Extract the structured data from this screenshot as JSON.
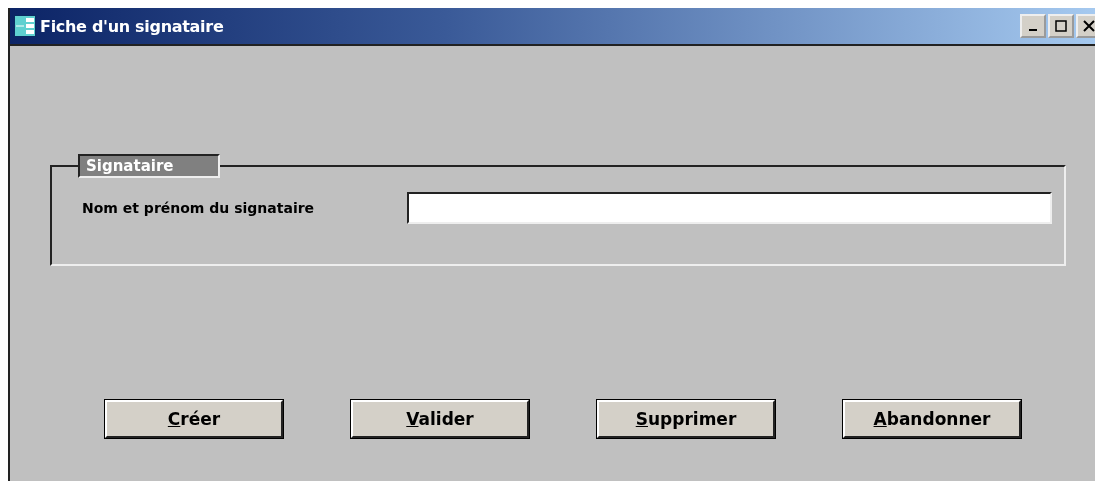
{
  "window": {
    "title": "Fiche d'un signataire"
  },
  "group": {
    "legend": "Signataire",
    "fields": [
      {
        "label": "Nom et prénom du signataire"
      }
    ]
  },
  "buttons": [
    {
      "label": "Créer"
    },
    {
      "label": "Valider"
    },
    {
      "label": "Supprimer"
    },
    {
      "label": "Abandonner"
    }
  ]
}
